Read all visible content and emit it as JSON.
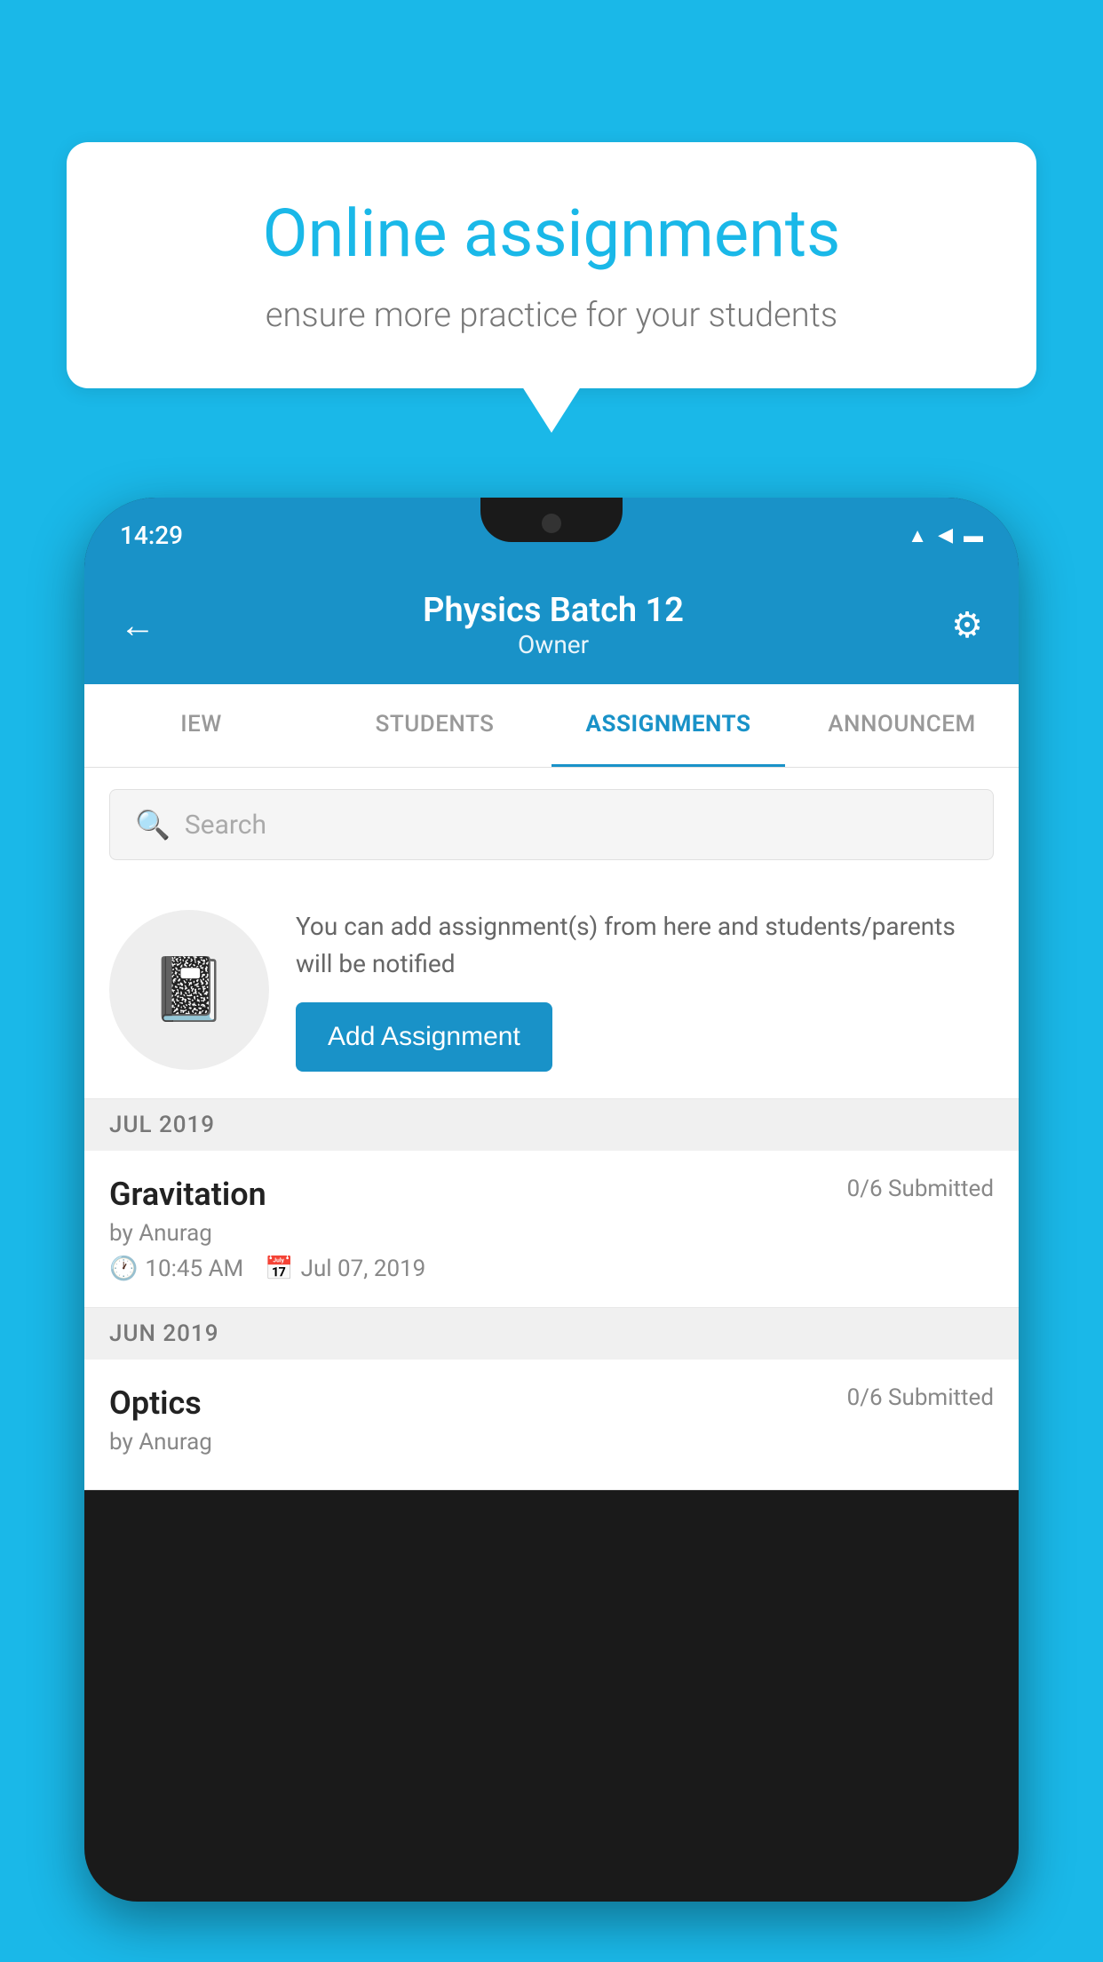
{
  "background_color": "#1ab8e8",
  "speech_bubble": {
    "title": "Online assignments",
    "subtitle": "ensure more practice for your students"
  },
  "phone": {
    "status_bar": {
      "time": "14:29",
      "icons": [
        "wifi",
        "signal",
        "battery"
      ]
    },
    "header": {
      "title": "Physics Batch 12",
      "subtitle": "Owner",
      "back_label": "←",
      "gear_label": "⚙"
    },
    "tabs": [
      {
        "label": "IEW",
        "active": false
      },
      {
        "label": "STUDENTS",
        "active": false
      },
      {
        "label": "ASSIGNMENTS",
        "active": true
      },
      {
        "label": "ANNOUNCEM",
        "active": false
      }
    ],
    "search": {
      "placeholder": "Search"
    },
    "promo": {
      "description": "You can add assignment(s) from here and students/parents will be notified",
      "button_label": "Add Assignment"
    },
    "sections": [
      {
        "month_label": "JUL 2019",
        "assignments": [
          {
            "name": "Gravitation",
            "submitted": "0/6 Submitted",
            "author": "by Anurag",
            "time": "10:45 AM",
            "date": "Jul 07, 2019"
          }
        ]
      },
      {
        "month_label": "JUN 2019",
        "assignments": [
          {
            "name": "Optics",
            "submitted": "0/6 Submitted",
            "author": "by Anurag",
            "time": "",
            "date": ""
          }
        ]
      }
    ]
  }
}
